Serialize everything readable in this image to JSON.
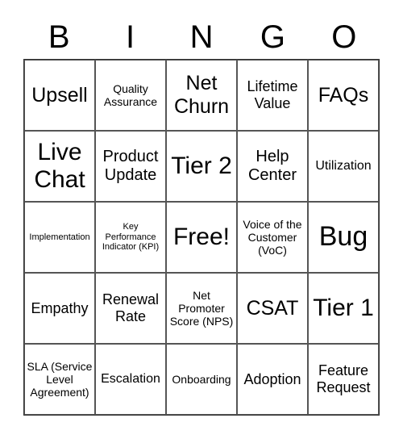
{
  "header": [
    "B",
    "I",
    "N",
    "G",
    "O"
  ],
  "cells": [
    {
      "text": "Upsell",
      "size": "s6"
    },
    {
      "text": "Quality Assurance",
      "size": "s2"
    },
    {
      "text": "Net Churn",
      "size": "s6"
    },
    {
      "text": "Lifetime Value",
      "size": "s4"
    },
    {
      "text": "FAQs",
      "size": "s6"
    },
    {
      "text": "Live Chat",
      "size": "s7"
    },
    {
      "text": "Product Update",
      "size": "s5"
    },
    {
      "text": "Tier 2",
      "size": "s7"
    },
    {
      "text": "Help Center",
      "size": "s5"
    },
    {
      "text": "Utilization",
      "size": "s3"
    },
    {
      "text": "Implementation",
      "size": "s1"
    },
    {
      "text": "Key Performance Indicator (KPI)",
      "size": "s1"
    },
    {
      "text": "Free!",
      "size": "s7"
    },
    {
      "text": "Voice of the Customer (VoC)",
      "size": "s2"
    },
    {
      "text": "Bug",
      "size": "s8"
    },
    {
      "text": "Empathy",
      "size": "s4"
    },
    {
      "text": "Renewal Rate",
      "size": "s4"
    },
    {
      "text": "Net Promoter Score (NPS)",
      "size": "s2"
    },
    {
      "text": "CSAT",
      "size": "s6"
    },
    {
      "text": "Tier 1",
      "size": "s7"
    },
    {
      "text": "SLA (Service Level Agreement)",
      "size": "s2"
    },
    {
      "text": "Escalation",
      "size": "s3"
    },
    {
      "text": "Onboarding",
      "size": "s2"
    },
    {
      "text": "Adoption",
      "size": "s4"
    },
    {
      "text": "Feature Request",
      "size": "s4"
    }
  ]
}
